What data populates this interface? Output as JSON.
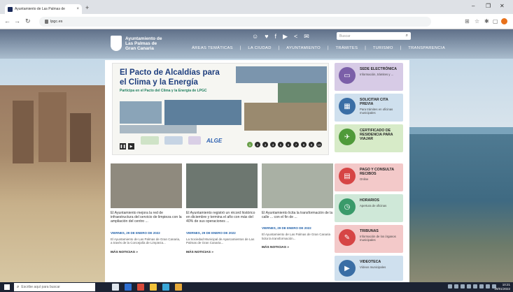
{
  "browser": {
    "tab_title": "Ayuntamiento de Las Palmas de",
    "tab_close": "×",
    "new_tab": "+",
    "url": "lpgc.es",
    "win_minimize": "–",
    "win_restore": "❐",
    "win_close": "✕",
    "back": "←",
    "forward": "→",
    "reload": "↻"
  },
  "site": {
    "logo_text": "Ayuntamiento de Las Palmas de Gran Canaria",
    "search_placeholder": "Buscar",
    "menu": [
      "ÁREAS TEMÁTICAS",
      "LA CIUDAD",
      "AYUNTAMIENTO",
      "TRÁMITES",
      "TURISMO",
      "TRANSPARENCIA"
    ],
    "social_icons": [
      "people-icon",
      "twitter-icon",
      "facebook-icon",
      "youtube-icon",
      "share-icon",
      "mail-icon"
    ]
  },
  "hero": {
    "title": "El Pacto de Alcaldías para el Clima y la Energía",
    "subtitle": "Participa en el Pacto del Clima y la Energía de LPGC",
    "partner": "ALGE",
    "dots": [
      "1",
      "2",
      "3",
      "4",
      "5",
      "6",
      "7",
      "8",
      "9",
      "10"
    ]
  },
  "tiles": [
    {
      "title": "SEDE ELECTRÓNICA",
      "sub": "Información, trámites y ...",
      "bg": "#d7cbe6",
      "icon_bg": "#7b5fa8",
      "icon": "laptop-icon",
      "glyph": "▭"
    },
    {
      "title": "SOLICITAR CITA PREVIA",
      "sub": "Para trámites en oficinas municipales",
      "bg": "#cfe0ee",
      "icon_bg": "#3a6ea5",
      "icon": "calendar-icon",
      "glyph": "▦"
    },
    {
      "title": "CERTIFICADO DE RESIDENCIA PARA VIAJAR",
      "sub": "",
      "bg": "#d7ebc8",
      "icon_bg": "#4f9a3a",
      "icon": "plane-icon",
      "glyph": "✈"
    },
    {
      "title": "PAGO Y CONSULTA RECIBOS",
      "sub": "Online",
      "bg": "#f3c9c9",
      "icon_bg": "#d64545",
      "icon": "receipt-icon",
      "glyph": "▤"
    },
    {
      "title": "HORARIOS",
      "sub": "Apertura de oficinas",
      "bg": "#cfe8d8",
      "icon_bg": "#3a9a6a",
      "icon": "clock-icon",
      "glyph": "◷"
    },
    {
      "title": "TRIBUNAS",
      "sub": "Información de los órganos municipales",
      "bg": "#f3c9c9",
      "icon_bg": "#d64545",
      "icon": "document-icon",
      "glyph": "✎"
    },
    {
      "title": "VIDEOTECA",
      "sub": "Vídeos municipales",
      "bg": "#cfe0ee",
      "icon_bg": "#3a6ea5",
      "icon": "video-icon",
      "glyph": "▶"
    }
  ],
  "news": [
    {
      "title": "El Ayuntamiento mejora la red de infraestructura del servicio de limpieza con la ampliación del centro ...",
      "date": "VIERNES, 29 DE ENERO DE 2022",
      "body": "El Ayuntamiento de Las Palmas de Gran Canaria, a través de la Concejalía de Limpieza...",
      "more": "MÁS NOTICIAS »",
      "img": "#8f8a7e"
    },
    {
      "title": "El Ayuntamiento registró un récord histórico en diciembre y termina el año con más del 40% de sus operaciones ...",
      "date": "VIERNES, 29 DE ENERO DE 2022",
      "body": "La Sociedad Municipal de Aparcamientos de Las Palmas de Gran Canaria...",
      "more": "MÁS NOTICIAS »",
      "img": "#6d7770"
    },
    {
      "title": "El Ayuntamiento licita la transformación de la calle ... con el fin de ...",
      "date": "VIERNES, 29 DE ENERO DE 2022",
      "body": "El Ayuntamiento de Las Palmas de Gran Canaria licita la transformación...",
      "more": "MÁS NOTICIAS »",
      "img": "#a9b0a4"
    }
  ],
  "taskbar": {
    "search_placeholder": "Escribe aquí para buscar",
    "time": "10:21",
    "date": "29/01/2022"
  }
}
